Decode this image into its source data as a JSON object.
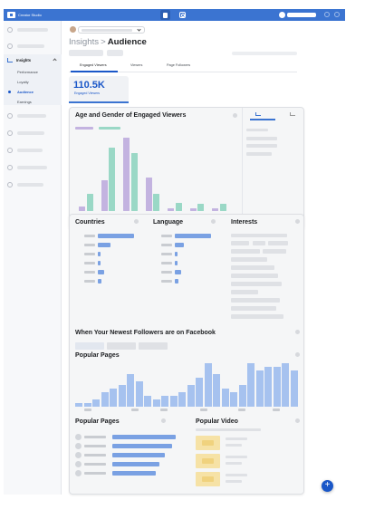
{
  "app": {
    "title": "Creator Studio"
  },
  "topbar": {
    "platform_tabs": [
      "facebook-icon",
      "instagram-icon"
    ]
  },
  "sidebar": {
    "section": {
      "label": "Insights"
    },
    "sub_items": [
      {
        "label": "Performance",
        "active": false
      },
      {
        "label": "Loyalty",
        "active": false
      },
      {
        "label": "Audience",
        "active": true
      },
      {
        "label": "Earnings",
        "active": false
      }
    ]
  },
  "header": {
    "breadcrumb_root": "Insights",
    "separator": ">",
    "title": "Audience"
  },
  "tabs": [
    {
      "label": "Engaged Viewers",
      "active": true
    },
    {
      "label": "Viewers",
      "active": false
    },
    {
      "label": "Page Followers",
      "active": false
    }
  ],
  "metric": {
    "value": "110.5K",
    "label": "Engaged Viewers"
  },
  "age_gender": {
    "title": "Age and Gender of Engaged Viewers",
    "chart_data": {
      "type": "bar",
      "categories": [
        "",
        "",
        "",
        "",
        "",
        "",
        ""
      ],
      "series": [
        {
          "values": [
            5,
            32,
            75,
            34,
            3,
            3,
            3
          ]
        },
        {
          "values": [
            18,
            65,
            60,
            18,
            8,
            7,
            7
          ]
        }
      ],
      "ylim": [
        0,
        80
      ]
    },
    "colors": {
      "series_a": "#c3b3e0",
      "series_b": "#9ad8c6"
    }
  },
  "countries": {
    "title": "Countries",
    "values": [
      40,
      14,
      3,
      3,
      7,
      4
    ]
  },
  "language": {
    "title": "Language",
    "values": [
      40,
      10,
      3,
      3,
      7,
      4
    ]
  },
  "interests": {
    "title": "Interests"
  },
  "newest_followers": {
    "title": "When Your Newest Followers are on Facebook"
  },
  "popular_pages_hist": {
    "title": "Popular Pages",
    "chart_data": {
      "type": "bar",
      "values": [
        1,
        1,
        2,
        4,
        5,
        6,
        9,
        7,
        3,
        2,
        3,
        3,
        4,
        6,
        8,
        12,
        9,
        5,
        4,
        6,
        12,
        10,
        11,
        11,
        12,
        10
      ],
      "ylim": [
        0,
        13
      ]
    }
  },
  "popular_pages": {
    "title": "Popular Pages",
    "values": [
      70,
      66,
      58,
      52,
      48
    ]
  },
  "popular_video": {
    "title": "Popular Video"
  },
  "colors": {
    "accent": "#1a57c8",
    "topbar": "#3b74d1",
    "bar_blue": "#7aa1e3"
  }
}
